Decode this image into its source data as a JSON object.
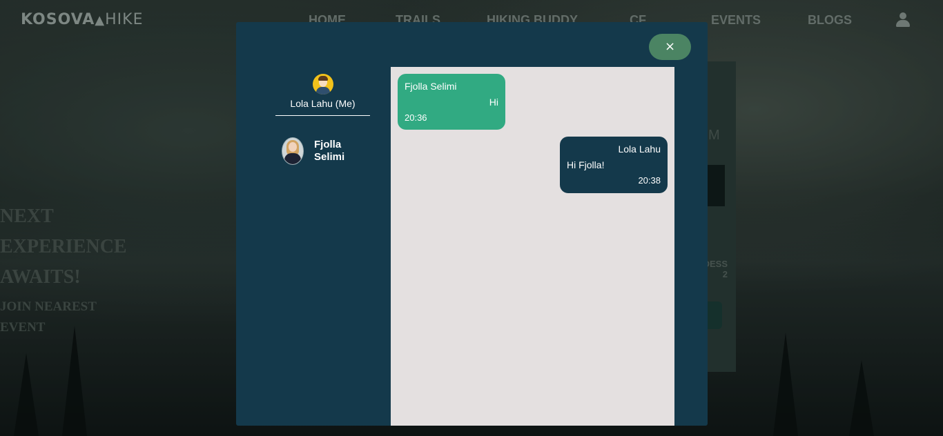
{
  "background": {
    "logo": {
      "bold": "KOSOVA",
      "thin": "HIKE"
    },
    "nav_links": [
      "HOME",
      "TRAILS",
      "HIKING BUDDY",
      "CF",
      "EVENTS",
      "BLOGS"
    ],
    "hero": {
      "lines": [
        "NEXT",
        "EXPERIENCE",
        "AWAITS!"
      ],
      "sub_lines": [
        "JOIN NEAREST",
        "EVENT"
      ]
    },
    "event_card": {
      "time_fragment": "M",
      "label_line1": "DESS",
      "label_line2": "2"
    }
  },
  "modal": {
    "close_label": "×",
    "me": {
      "name": "Lola Lahu (Me)"
    },
    "contacts": [
      {
        "name": "Fjolla Selimi"
      }
    ],
    "messages": [
      {
        "direction": "in",
        "sender": "Fjolla Selimi",
        "text": "Hi",
        "time": "20:36"
      },
      {
        "direction": "out",
        "sender": "Lola Lahu",
        "text": "Hi Fjolla!",
        "time": "20:38"
      }
    ]
  },
  "colors": {
    "modal_bg": "#14394b",
    "chat_bg": "#e4e0e0",
    "incoming_bubble": "#31aa82",
    "outgoing_bubble": "#14394b",
    "close_button": "#4b8463"
  }
}
